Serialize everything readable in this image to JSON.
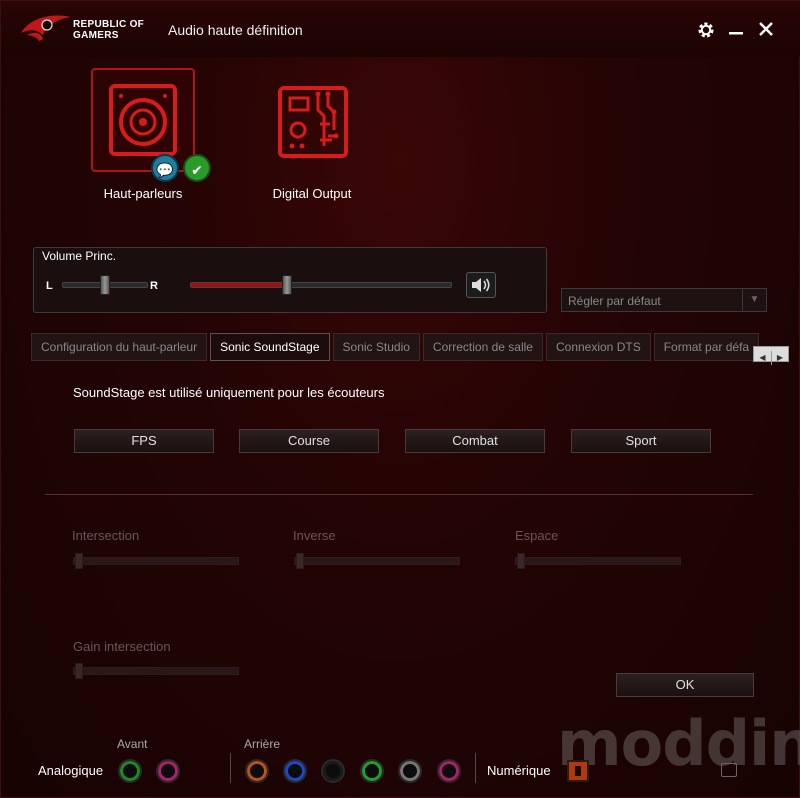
{
  "window": {
    "brand_line1": "REPUBLIC OF",
    "brand_line2": "GAMERS",
    "title": "Audio haute définition",
    "icons": [
      "settings-icon",
      "minimize-icon",
      "close-icon"
    ]
  },
  "devices": [
    {
      "label": "Haut-parleurs",
      "selected": true,
      "default": true
    },
    {
      "label": "Digital Output",
      "selected": false,
      "default": false
    }
  ],
  "volume": {
    "title": "Volume Princ.",
    "balance_left": "L",
    "balance_right": "R",
    "balance_value": 0.5,
    "level": 0.37,
    "accent": "#a01010"
  },
  "default_dropdown": {
    "label": "Régler par défaut"
  },
  "tabs": [
    {
      "label": "Configuration du haut-parleur",
      "active": false
    },
    {
      "label": "Sonic SoundStage",
      "active": true
    },
    {
      "label": "Sonic Studio",
      "active": false
    },
    {
      "label": "Correction de salle",
      "active": false
    },
    {
      "label": "Connexion DTS",
      "active": false
    },
    {
      "label": "Format par défa",
      "active": false
    }
  ],
  "soundstage": {
    "description": "SoundStage est utilisé uniquement pour les écouteurs",
    "presets": [
      "FPS",
      "Course",
      "Combat",
      "Sport"
    ],
    "sliders": [
      {
        "label": "Intersection"
      },
      {
        "label": "Inverse"
      },
      {
        "label": "Espace"
      },
      {
        "label": "Gain intersection"
      }
    ],
    "ok_label": "OK"
  },
  "jacks": {
    "front_label": "Avant",
    "rear_label": "Arrière",
    "analog_label": "Analogique",
    "digital_label": "Numérique",
    "front_colors": [
      "#1f8a2a",
      "#b0206a"
    ],
    "rear_colors": [
      "#c0501a",
      "#1e48c8",
      "#1a1a1a",
      "#1fa030",
      "#777777",
      "#b0206a"
    ]
  },
  "watermark": "modding.fr"
}
